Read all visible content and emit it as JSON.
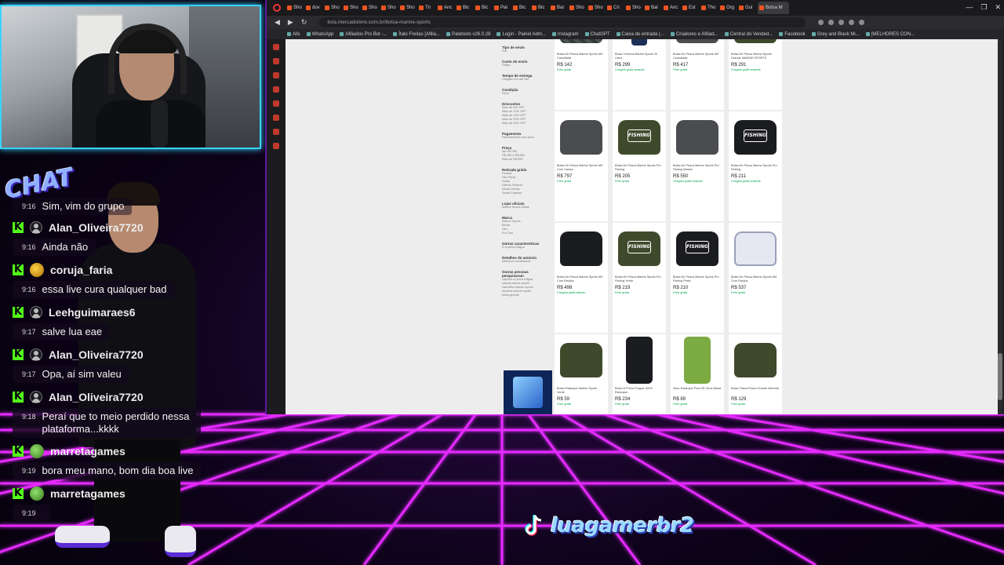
{
  "chat": {
    "badge": "CHAT",
    "partial_message": "Sim, vim do grupo",
    "partial_time": "9:16",
    "messages": [
      {
        "user": "Alan_Oliveira7720",
        "time": "9:16",
        "text": "Ainda não",
        "avatar": "user"
      },
      {
        "user": "coruja_faria",
        "time": "9:16",
        "text": "essa live cura qualquer bad",
        "avatar": "owl"
      },
      {
        "user": "Leehguimaraes6",
        "time": "9:17",
        "text": "salve lua eae",
        "avatar": "user"
      },
      {
        "user": "Alan_Oliveira7720",
        "time": "9:17",
        "text": "Opa, aí sim valeu",
        "avatar": "user"
      },
      {
        "user": "Alan_Oliveira7720",
        "time": "9:18",
        "text": "Peraí que to meio perdido nessa plataforma...kkkk",
        "avatar": "user"
      },
      {
        "user": "marretagames",
        "time": "9:19",
        "text": "bora meu mano, bom dia boa live",
        "avatar": "img"
      },
      {
        "user": "marretagames",
        "time": "9:19",
        "text": "",
        "avatar": "img"
      }
    ]
  },
  "browser": {
    "tabs": [
      "Sho",
      "dov",
      "Sho",
      "Sho",
      "Sho",
      "Sho",
      "Sho",
      "Tri",
      "Anc",
      "Bic",
      "Bic",
      "Pat",
      "Bic",
      "Bic",
      "Bar",
      "Sho",
      "Sho",
      "Cri",
      "Sho",
      "Bal",
      "Anc",
      "Est",
      "Tho",
      "Org",
      "Gui"
    ],
    "active_tab": "Bolsa M",
    "url": "lista.mercadolivre.com.br/bolsa-marine-sports",
    "bookmarks": [
      "Alls",
      "WhatsApp",
      "Afiliados Pro Bot -...",
      "Ítalo Freitas [Afilia...",
      "Paletools v26.0.28",
      "Login - Painel Adm...",
      "Instagram",
      "ChatGPT",
      "Caixa de entrada (...",
      "Criadores e Afiliad...",
      "Central do Vended...",
      "Facebook",
      "Grey and Black Mi...",
      "[MELHORES CON..."
    ],
    "filters": [
      {
        "h": "Tipo de envío",
        "items": [
          "Full"
        ]
      },
      {
        "h": "Custo do envio",
        "items": [
          "Grátis"
        ]
      },
      {
        "h": "Tempo de entrega",
        "items": [
          "Chegam em até 24h"
        ]
      },
      {
        "h": "Condição",
        "items": [
          "Novo"
        ]
      },
      {
        "h": "Descontos",
        "items": [
          "Mais de 5% OFF",
          "Mais de 10% OFF",
          "Mais de 15% OFF",
          "Mais de 20% OFF",
          "Mais de 25% OFF"
        ]
      },
      {
        "h": "Pagamento",
        "items": [
          "Parcelamento sem juros"
        ]
      },
      {
        "h": "Preço",
        "items": [
          "Até R$ 250",
          "R$ 250 a R$ 550",
          "Mais de R$ 550"
        ]
      },
      {
        "h": "Retirada grátis",
        "items": [
          "Paraná",
          "São Paulo",
          "Goiás",
          "Distrito Federal",
          "Minas Gerais",
          "Santa Catarina"
        ]
      },
      {
        "h": "Lojas oficiais",
        "items": [
          "Marine Sports oficial"
        ]
      },
      {
        "h": "Marca",
        "items": [
          "Marine Sports",
          "Benta",
          "Neo",
          "Pro Tool"
        ]
      },
      {
        "h": "Outras características",
        "items": [
          "É à prova d'água"
        ]
      },
      {
        "h": "Detalhes do anúncio",
        "items": [
          "Melhores vendedores"
        ]
      },
      {
        "h": "Outras pessoas pesquisaram",
        "items": [
          "capinha à prova d'água",
          "sacola marine sports",
          "carretilha marine sports",
          "mochila marine sports",
          "bolsa grande"
        ]
      }
    ],
    "products": [
      {
        "title": "Bolsa De Pesca Marine Sports Mlf Camuflada",
        "price": "R$ 142",
        "bag": "camo",
        "note": "Frete grátis"
      },
      {
        "title": "Bolsa Térmica Marine Sports 20 Litros",
        "price": "R$ 299",
        "bag": "bottle",
        "note": "Chegará grátis amanhã"
      },
      {
        "title": "Bolsa De Pesca Marine Sports Mlf Camuflada",
        "price": "R$ 417",
        "bag": "grey",
        "note": "Frete grátis"
      },
      {
        "title": "Bolsa De Pesca Marine Sports Grande MARINE SPORTS",
        "price": "R$ 291",
        "bag": "olive",
        "note": "Chegará grátis amanhã"
      },
      {
        "title": "Bolsa De Pesca Marine Sports Mlf Com Caixas",
        "price": "R$ 797",
        "bag": "grey",
        "note": "Frete grátis"
      },
      {
        "title": "Bolsa De Pesca Marine Sports Pro Fishing",
        "price": "R$ 205",
        "bag": "olive-logo",
        "note": "Frete grátis"
      },
      {
        "title": "Bolsa De Pesca Marine Sports Pro Fishing Marine",
        "price": "R$ 550",
        "bag": "grey",
        "note": "Chegará grátis amanhã"
      },
      {
        "title": "Bolsa De Pesca Marine Sports Pro Fishing",
        "price": "R$ 211",
        "bag": "black-logo",
        "note": "Chegará grátis amanhã"
      },
      {
        "title": "Bolsa De Pesca Marine Sports Mlf Com Estojos",
        "price": "R$ 498",
        "bag": "black",
        "note": "Chegará grátis sábado"
      },
      {
        "title": "Bolsa De Pesca Marine Sports Pro Fishing Verde",
        "price": "R$ 219",
        "bag": "olive-logo",
        "note": "Frete grátis"
      },
      {
        "title": "Bolsa De Pesca Marine Sports Pro Fishing Preta",
        "price": "R$ 210",
        "bag": "black-logo",
        "note": "Frete grátis"
      },
      {
        "title": "Bolsa De Pesca Marine Sports Mlf Com Estojos",
        "price": "R$ 537",
        "bag": "white",
        "note": "Frete grátis"
      },
      {
        "title": "Bolsa Estanque Marine Sports Verde",
        "price": "R$ 59",
        "bag": "olive",
        "note": "Frete grátis"
      },
      {
        "title": "Bolsa À Prova D'água 100% Estanque",
        "price": "R$ 234",
        "bag": "drybag-black",
        "note": "Frete grátis"
      },
      {
        "title": "Saco Estanque Para 30 Litros Bolsa",
        "price": "R$ 89",
        "bag": "drybag-light",
        "note": "Frete grátis"
      },
      {
        "title": "Bolsa Tática Pesca Grande Marinha",
        "price": "R$ 129",
        "bag": "olive",
        "note": "Frete grátis"
      }
    ]
  },
  "streamer": {
    "handle": "luagamerbr2"
  },
  "colors": {
    "neon_pink": "#e52bff",
    "neon_blue": "#38d3ff",
    "kick_green": "#53fc18"
  }
}
